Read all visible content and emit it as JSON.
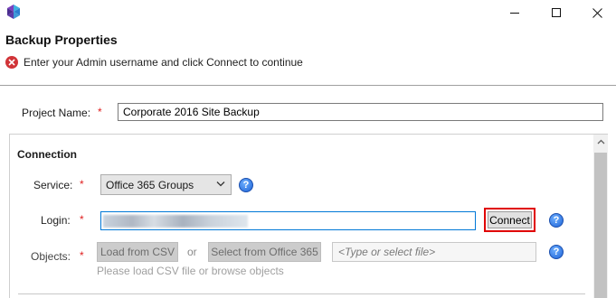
{
  "window": {
    "minimize_icon": "minimize-icon",
    "maximize_icon": "maximize-icon",
    "close_icon": "close-icon"
  },
  "dialog": {
    "title": "Backup Properties",
    "error_message": "Enter your Admin username and click Connect to continue",
    "error_color": "#d13438"
  },
  "project": {
    "label": "Project Name:",
    "required_mark": "*",
    "value": "Corporate 2016 Site Backup"
  },
  "connection": {
    "section_title": "Connection",
    "service": {
      "label": "Service:",
      "required_mark": "*",
      "selected": "Office 365 Groups"
    },
    "login": {
      "label": "Login:",
      "required_mark": "*",
      "connect_label": "Connect",
      "highlight_color": "#e00000"
    },
    "objects": {
      "label": "Objects:",
      "required_mark": "*",
      "load_csv_label": "Load from CSV",
      "or_label": "or",
      "select_o365_label": "Select from Office 365",
      "file_placeholder": "<Type or select file>",
      "hint": "Please load CSV file or browse objects"
    },
    "help_glyph": "?"
  }
}
